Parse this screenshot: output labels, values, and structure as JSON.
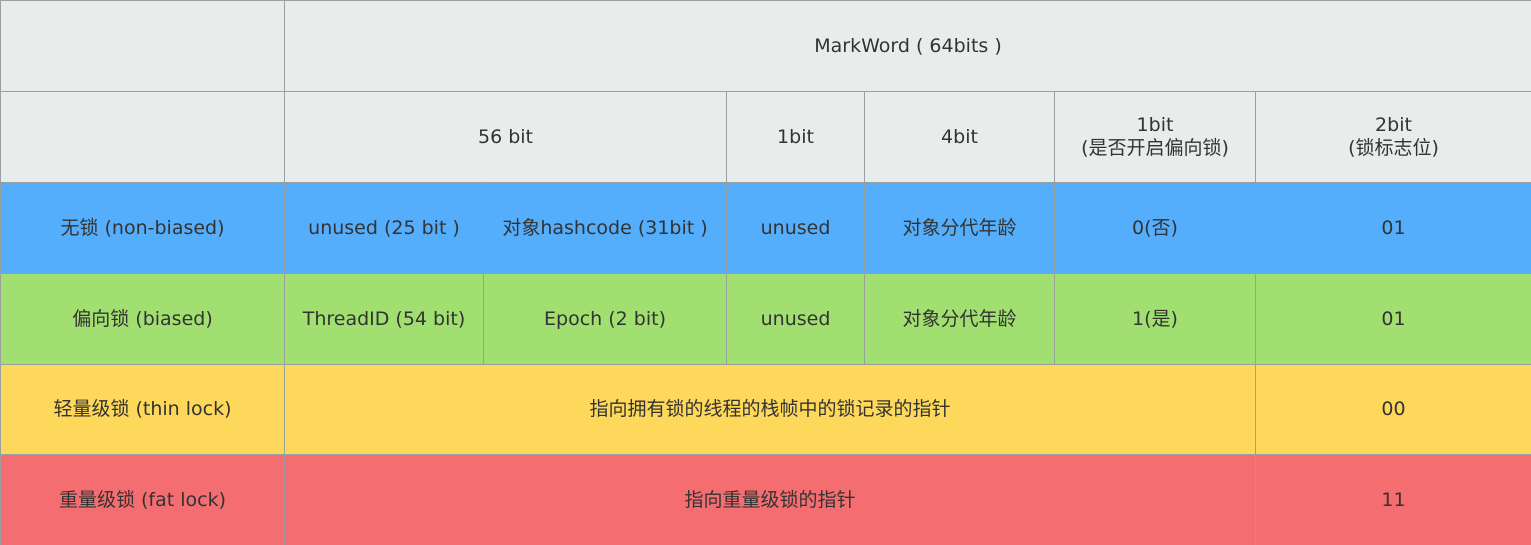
{
  "header": {
    "markword_title": "MarkWord ( 64bits )",
    "col_56bit": "56 bit",
    "col_1bit": "1bit",
    "col_4bit": "4bit",
    "col_biased_flag": "1bit",
    "col_biased_flag_desc": "(是否开启偏向锁)",
    "col_lock_flag": "2bit",
    "col_lock_flag_desc": "(锁标志位)"
  },
  "rows": {
    "no_lock": {
      "label": "无锁 (non-biased)",
      "unused_25": "unused (25 bit )",
      "hashcode": "对象hashcode (31bit )",
      "unused": "unused",
      "age": "对象分代年龄",
      "biased": "0(否)",
      "flag": "01",
      "color": "#55aefc"
    },
    "biased_lock": {
      "label": "偏向锁 (biased)",
      "thread_id": "ThreadID (54 bit)",
      "epoch": "Epoch (2 bit)",
      "unused": "unused",
      "age": "对象分代年龄",
      "biased": "1(是)",
      "flag": "01",
      "color": "#a1df70"
    },
    "thin_lock": {
      "label": "轻量级锁 (thin lock)",
      "pointer": "指向拥有锁的线程的栈帧中的锁记录的指针",
      "flag": "00",
      "color": "#fdd85a"
    },
    "fat_lock": {
      "label": "重量级锁 (fat lock)",
      "pointer": "指向重量级锁的指针",
      "flag": "11",
      "color": "#f46d71"
    }
  },
  "colors": {
    "header_bg": "#e8eceb",
    "border": "#9aa0a0",
    "text": "#333333"
  }
}
